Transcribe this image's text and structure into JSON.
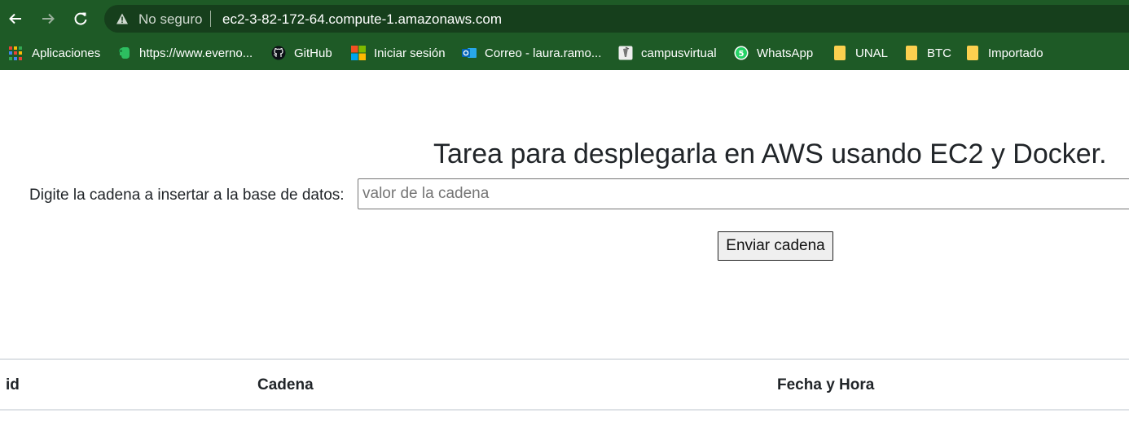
{
  "browser": {
    "security_label": "No seguro",
    "url": "ec2-3-82-172-64.compute-1.amazonaws.com",
    "bookmarks": [
      {
        "label": "Aplicaciones",
        "icon": "apps-grid-icon"
      },
      {
        "label": "https://www.everno...",
        "icon": "evernote-icon"
      },
      {
        "label": "GitHub",
        "icon": "github-icon"
      },
      {
        "label": "Iniciar sesión",
        "icon": "microsoft-icon"
      },
      {
        "label": "Correo - laura.ramo...",
        "icon": "outlook-icon"
      },
      {
        "label": "campusvirtual",
        "icon": "campusvirtual-icon"
      },
      {
        "label": "WhatsApp",
        "icon": "whatsapp-icon"
      },
      {
        "label": "UNAL",
        "icon": "folder-icon"
      },
      {
        "label": "BTC",
        "icon": "folder-icon"
      },
      {
        "label": "Importado",
        "icon": "folder-icon"
      }
    ],
    "colors": {
      "toolbar": "#1e5a26",
      "omnibox": "#163f1c",
      "folder": "#fbd04f"
    }
  },
  "page": {
    "title": "Tarea para desplegarla en AWS usando EC2 y Docker.",
    "input_label": "Digite la cadena a insertar a la base de datos:",
    "input_placeholder": "valor de la cadena",
    "input_value": "",
    "submit_label": "Enviar cadena",
    "table": {
      "headers": [
        "id",
        "Cadena",
        "Fecha y Hora"
      ],
      "rows": []
    }
  }
}
